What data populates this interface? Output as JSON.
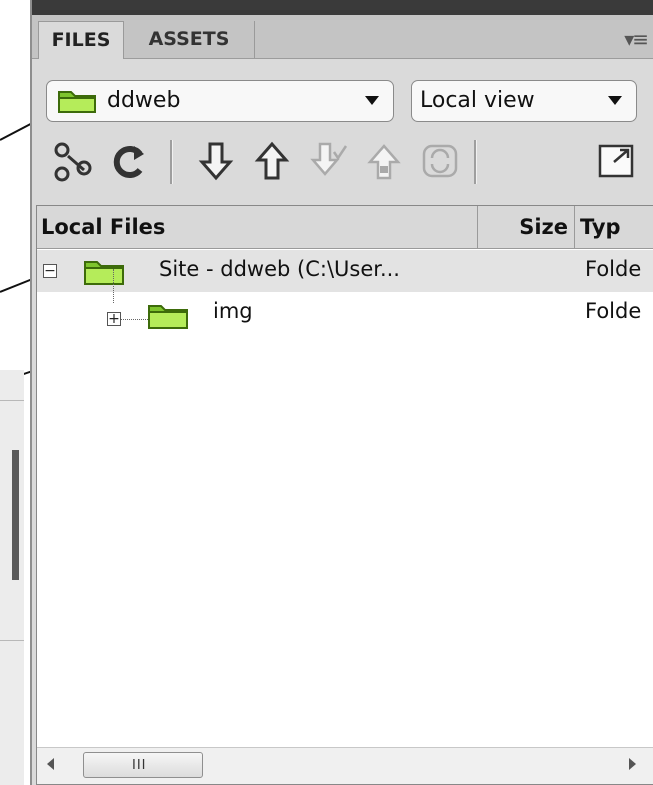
{
  "tabs": [
    {
      "label": "FILES",
      "active": true
    },
    {
      "label": "ASSETS",
      "active": false
    }
  ],
  "panel_menu_icon": "panel-options-icon",
  "site_select": {
    "value": "ddweb",
    "icon": "folder-icon"
  },
  "view_select": {
    "value": "Local view"
  },
  "toolbar": {
    "buttons": [
      {
        "name": "connect-icon",
        "enabled": true
      },
      {
        "name": "refresh-icon",
        "enabled": true
      },
      {
        "name": "get-files-icon",
        "enabled": true
      },
      {
        "name": "put-files-icon",
        "enabled": true
      },
      {
        "name": "check-out-icon",
        "enabled": false
      },
      {
        "name": "check-in-icon",
        "enabled": false
      },
      {
        "name": "synchronize-icon",
        "enabled": false
      },
      {
        "name": "expand-panel-icon",
        "enabled": true
      }
    ]
  },
  "file_list": {
    "columns": [
      "Local Files",
      "Size",
      "Typ"
    ],
    "rows": [
      {
        "name": "Site - ddweb (C:\\User...",
        "type": "Folde",
        "expander": "−",
        "selected": true
      },
      {
        "name": "img",
        "type": "Folde",
        "expander": "+",
        "selected": false
      }
    ]
  },
  "scrollbar": {
    "grip": "III"
  },
  "colors": {
    "panel_bg": "#dadada",
    "folder_green": "#8fd63a",
    "selected_row": "#e3e3e3"
  }
}
